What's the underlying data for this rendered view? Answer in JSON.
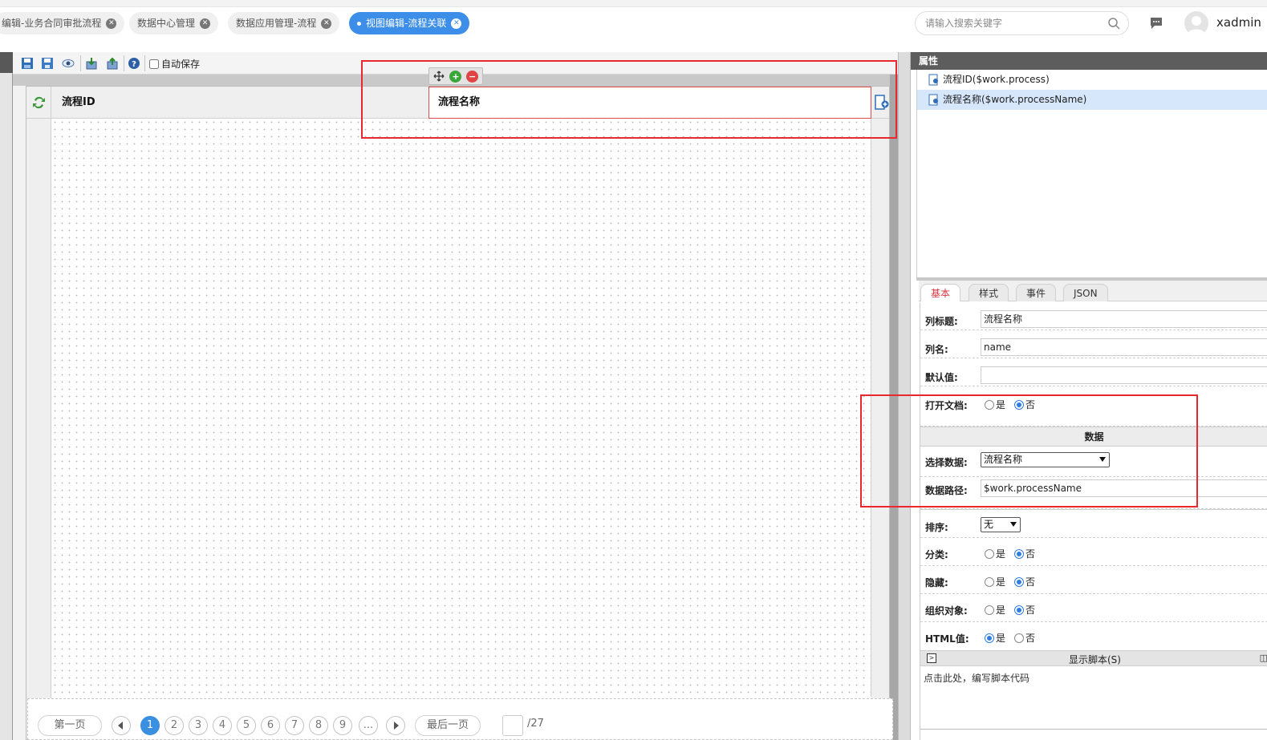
{
  "tabs": [
    {
      "label": "编辑-业务合同审批流程",
      "active": false
    },
    {
      "label": "数据中心管理",
      "active": false
    },
    {
      "label": "数据应用管理-流程",
      "active": false
    },
    {
      "label": "视图编辑-流程关联",
      "active": true
    }
  ],
  "header": {
    "search_placeholder": "请输入搜索关键字",
    "username": "xadmin"
  },
  "toolbar": {
    "autosave_label": "自动保存",
    "autosave_checked": false,
    "icons": [
      "save-icon",
      "save-as-icon",
      "preview-icon",
      "import-icon",
      "export-icon",
      "help-icon"
    ]
  },
  "grid": {
    "columns": [
      "流程ID",
      "流程名称"
    ],
    "selected_column": "流程名称"
  },
  "pager": {
    "first_label": "第一页",
    "last_label": "最后一页",
    "pages": [
      "1",
      "2",
      "3",
      "4",
      "5",
      "6",
      "7",
      "8",
      "9",
      "..."
    ],
    "current_page": "1",
    "total_label": "/27"
  },
  "props": {
    "title": "属性",
    "tree": [
      {
        "label": "流程ID($work.process)",
        "selected": false
      },
      {
        "label": "流程名称($work.processName)",
        "selected": true
      }
    ],
    "tabs": [
      {
        "label": "基本",
        "active": true
      },
      {
        "label": "样式",
        "active": false
      },
      {
        "label": "事件",
        "active": false
      },
      {
        "label": "JSON",
        "active": false
      }
    ],
    "fields": {
      "column_title_label": "列标题:",
      "column_title_value": "流程名称",
      "column_name_label": "列名:",
      "column_name_value": "name",
      "default_label": "默认值:",
      "default_value": "",
      "open_doc_label": "打开文档:",
      "data_section": "数据",
      "select_data_label": "选择数据:",
      "select_data_value": "流程名称",
      "data_path_label": "数据路径:",
      "data_path_value": "$work.processName",
      "sort_label": "排序:",
      "sort_value": "无",
      "category_label": "分类:",
      "hidden_label": "隐藏:",
      "org_label": "组织对象:",
      "html_label": "HTML值:",
      "yes": "是",
      "no": "否",
      "script_label": "显示脚本(S)",
      "script_hint": "点击此处，编写脚本代码"
    },
    "radios": {
      "open_doc": "否",
      "category": "否",
      "hidden": "否",
      "org": "否",
      "html": "是"
    }
  }
}
